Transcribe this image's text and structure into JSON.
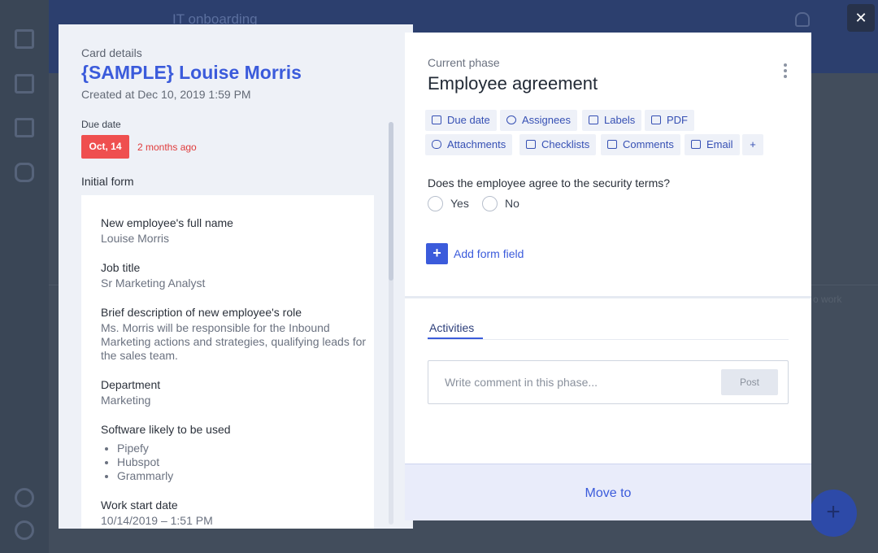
{
  "app": {
    "pipe_title": "IT onboarding",
    "close_glyph": "✕",
    "fab_glyph": "+",
    "bg_hint": "o work"
  },
  "card": {
    "section_label": "Card details",
    "title": "{SAMPLE} Louise Morris",
    "created": "Created at Dec 10, 2019 1:59 PM",
    "due_label": "Due date",
    "due_badge": "Oct, 14",
    "due_relative": "2 months ago",
    "due_color": "#ef4f4f",
    "form_label": "Initial form",
    "fields": [
      {
        "label": "New employee's full name",
        "value": "Louise Morris"
      },
      {
        "label": "Job title",
        "value": "Sr Marketing Analyst"
      },
      {
        "label": "Brief description of new employee's role",
        "value": "Ms. Morris will be responsible for the Inbound Marketing actions and strategies, qualifying leads for the sales team."
      },
      {
        "label": "Department",
        "value": "Marketing"
      },
      {
        "label": "Software likely to be used",
        "items": [
          "Pipefy",
          "Hubspot",
          "Grammarly"
        ]
      },
      {
        "label": "Work start date",
        "value": "10/14/2019 – 1:51 PM"
      }
    ]
  },
  "phase": {
    "label": "Current phase",
    "title": "Employee agreement",
    "actions": [
      {
        "label": "Due date",
        "icon": "calendar-icon"
      },
      {
        "label": "Assignees",
        "icon": "users-icon"
      },
      {
        "label": "Labels",
        "icon": "tag-icon"
      },
      {
        "label": "PDF",
        "icon": "file-icon"
      },
      {
        "label": "Attachments",
        "icon": "paperclip-icon"
      },
      {
        "label": "Checklists",
        "icon": "checklist-icon"
      },
      {
        "label": "Comments",
        "icon": "comment-icon"
      },
      {
        "label": "Email",
        "icon": "mail-icon"
      },
      {
        "label": "+",
        "icon": "plus-icon"
      }
    ],
    "question": "Does the employee agree to the security terms?",
    "options": [
      "Yes",
      "No"
    ],
    "add_field_glyph": "+",
    "add_field_label": "Add form field",
    "activities_tab": "Activities",
    "comment_placeholder": "Write comment in this phase...",
    "post_label": "Post",
    "move_label": "Move to",
    "accent_color": "#3b5bdb"
  }
}
